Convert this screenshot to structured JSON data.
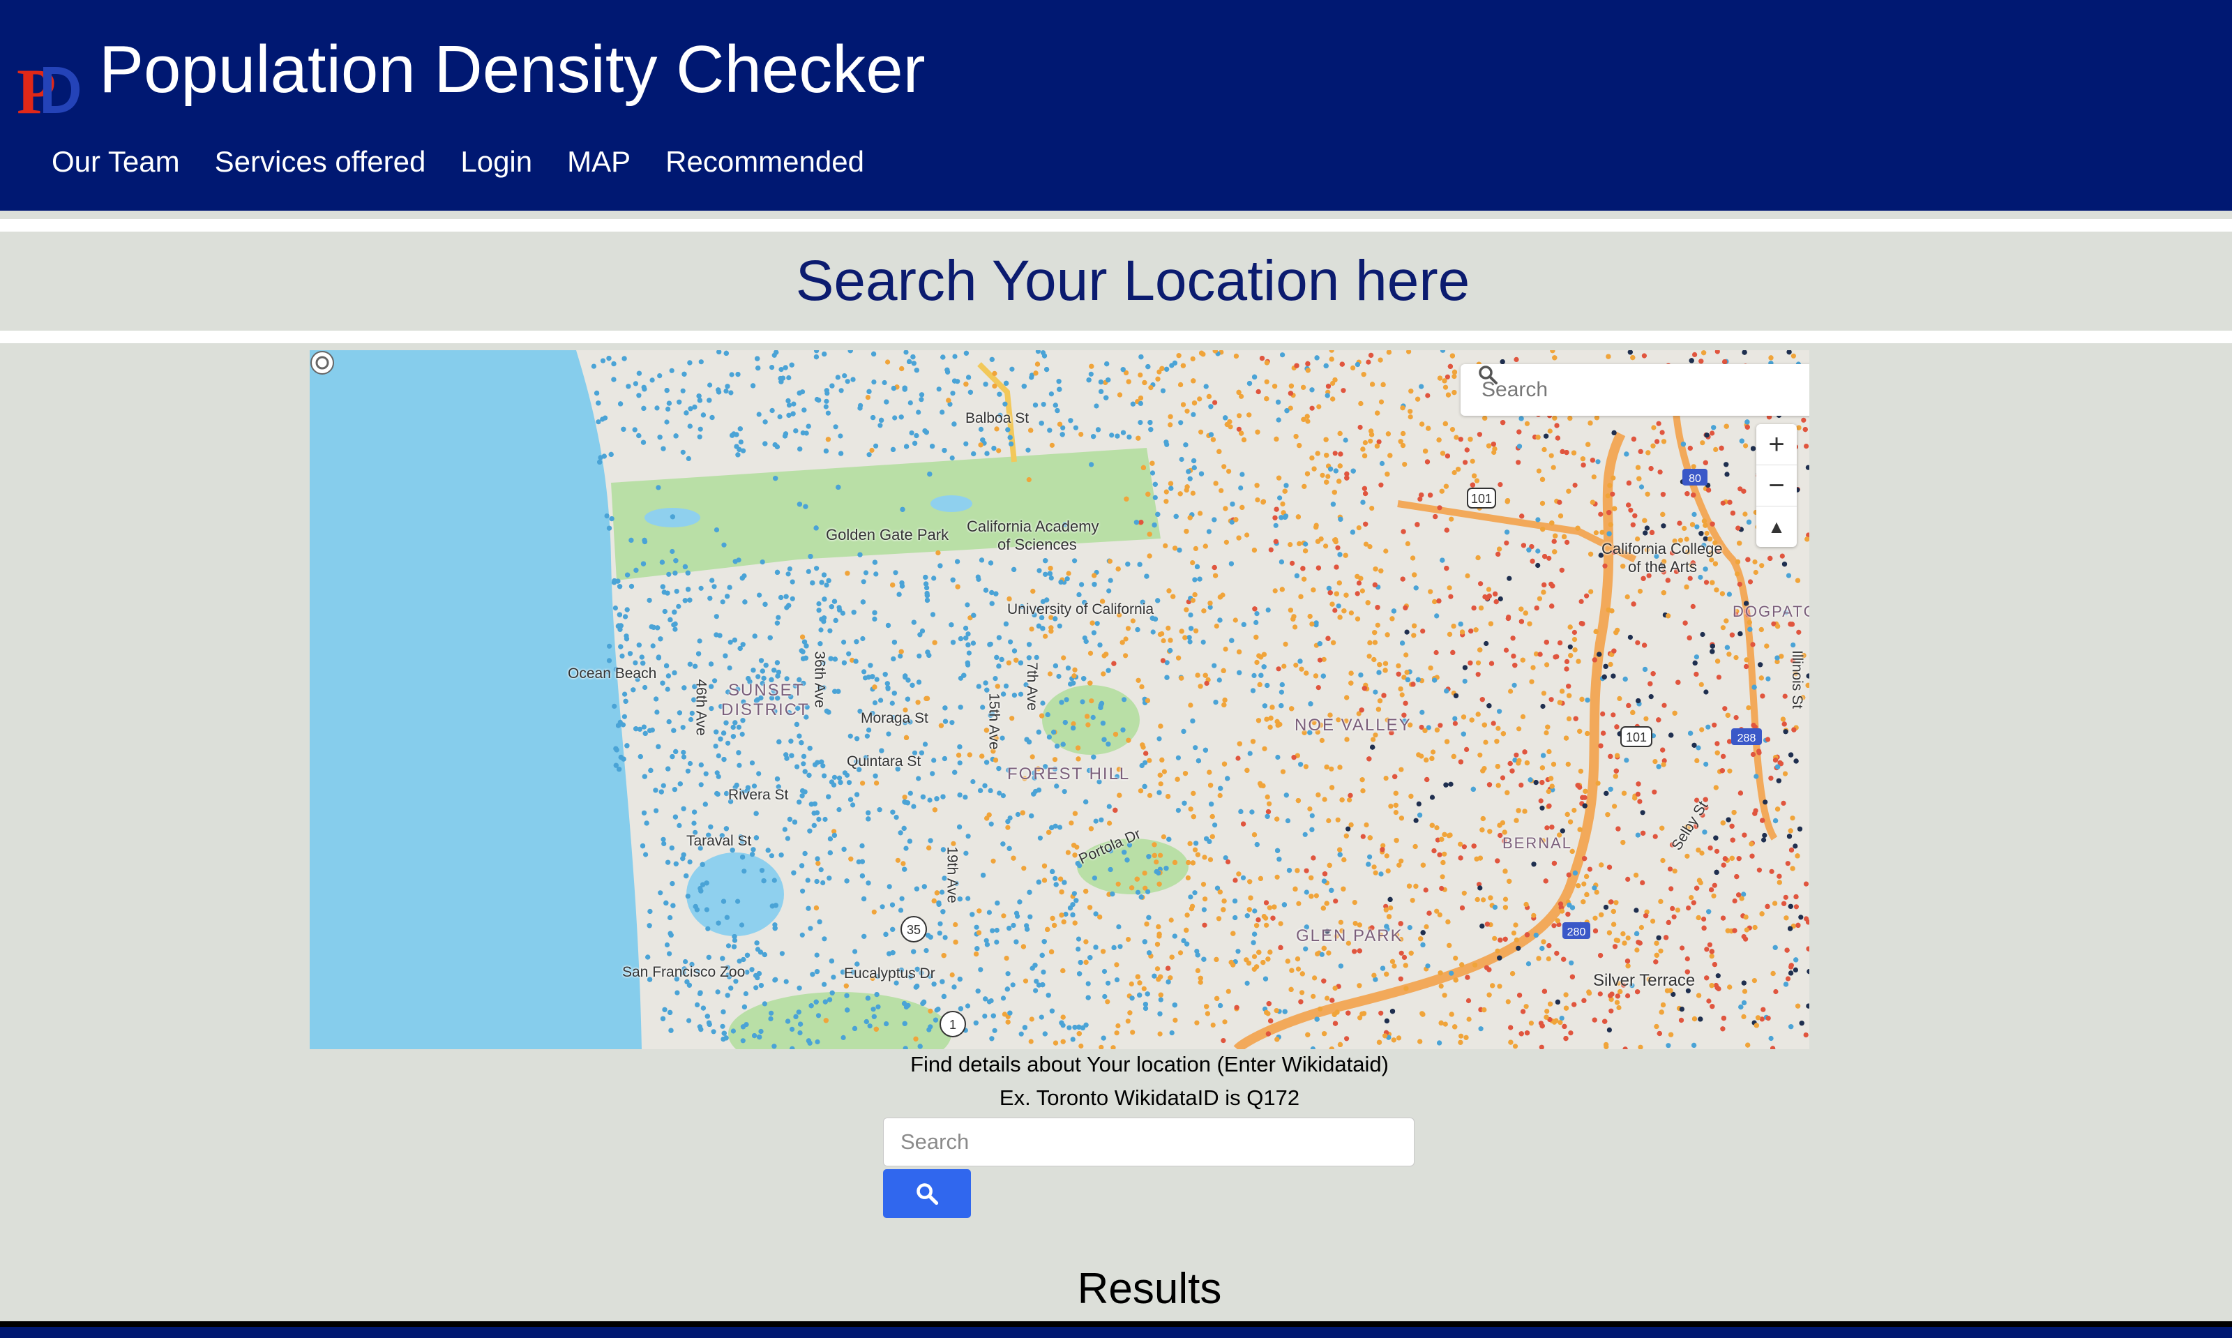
{
  "header": {
    "title": "Population Density Checker",
    "logo_letter": "P",
    "nav": [
      "Our Team",
      "Services offered",
      "Login",
      "MAP",
      "Recommended"
    ]
  },
  "banner": {
    "heading": "Search Your Location here"
  },
  "map": {
    "search_placeholder": "Search",
    "labels": {
      "golden_gate_park": "Golden Gate Park",
      "cal_academy_1": "California Academy",
      "cal_academy_2": "of Sciences",
      "ocean_beach": "Ocean Beach",
      "forest_hill": "FOREST HILL",
      "sf_zoo": "San Francisco Zoo",
      "cal_college_1": "California College",
      "cal_college_2": "of the Arts",
      "university": "University of California",
      "sunset": "SUNSET",
      "district": "DISTRICT",
      "glen_park": "GLEN PARK",
      "dogpatch": "DOGPATCH",
      "noe_valley": "NOE VALLEY",
      "bernal": "BERNAL",
      "quintara": "Quintara St",
      "rivera": "Rivera St",
      "taraval": "Taraval St",
      "eucalyptus": "Eucalyptus Dr",
      "portola": "Portola Dr",
      "balboa": "Balboa St",
      "moraga": "Moraga St",
      "illinois": "Illinois St",
      "selby": "Selby St",
      "silver_terrace": "Silver Terrace",
      "ave_19th": "19th Ave",
      "ave_15th": "15th Ave",
      "ave_7th": "7th Ave",
      "ave_36th": "36th Ave",
      "ave_46th": "46th Ave",
      "hwy_101a": "101",
      "hwy_101b": "101",
      "hwy_280": "280",
      "hwy_288": "288",
      "hwy_35": "35",
      "hwy_1": "1",
      "hwy_80": "80"
    },
    "controls": {
      "zoom_in": "+",
      "zoom_out": "−",
      "compass": "▲"
    },
    "dot_colors": {
      "low": "#4aa3d6",
      "mid": "#f0a43a",
      "high": "#e0553e",
      "very_high": "#1f2f4f"
    }
  },
  "lookup": {
    "line1": "Find details about Your location (Enter Wikidataid)",
    "line2": "Ex. Toronto WikidataID is Q172",
    "placeholder": "Search",
    "button_icon": "search-icon"
  },
  "results": {
    "heading": "Results"
  }
}
